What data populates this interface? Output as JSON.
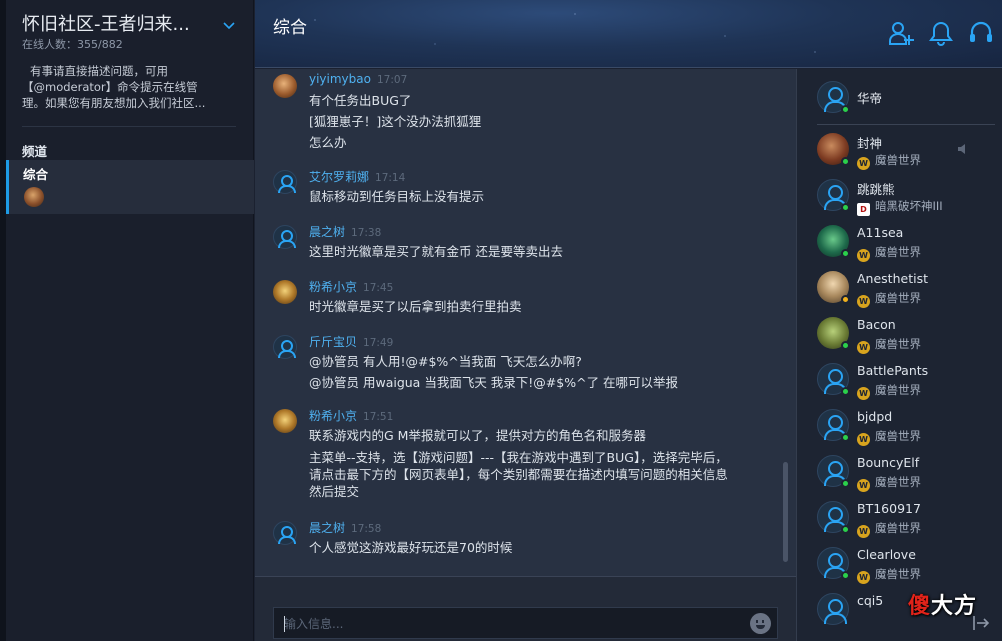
{
  "community": {
    "title": "怀旧社区-王者归来...",
    "online": "在线人数：355/882",
    "notice_lines": [
      "有事请直接描述问题，可用",
      "【@moderator】命令提示在线管",
      "理。如果您有朋友想加入我们社区..."
    ],
    "channels_heading": "频道",
    "channel_name": "综合"
  },
  "header": {
    "title": "综合",
    "icons": [
      "add-friend-icon",
      "bell-icon",
      "headset-icon"
    ],
    "accent": "#2aa4f4"
  },
  "messages": [
    {
      "author": "yiyimybao",
      "time": "17:07",
      "lines": [
        "有个任务出BUG了",
        "[狐狸崽子！]这个没办法抓狐狸",
        "怎么办"
      ]
    },
    {
      "author": "艾尔罗莉娜",
      "time": "17:14",
      "lines": [
        "鼠标移动到任务目标上没有提示"
      ]
    },
    {
      "author": "晨之树",
      "time": "17:38",
      "lines": [
        "这里时光徽章是买了就有金币 还是要等卖出去"
      ]
    },
    {
      "author": "粉希小京",
      "time": "17:45",
      "lines": [
        "时光徽章是买了以后拿到拍卖行里拍卖"
      ]
    },
    {
      "author": "斤斤宝贝",
      "time": "17:49",
      "lines": [
        "@协管员 有人用!@#$%^当我面 飞天怎么办啊?",
        "@协管员 用waigua 当我面飞天 我录下!@#$%^了 在哪可以举报"
      ]
    },
    {
      "author": "粉希小京",
      "time": "17:51",
      "lines": [
        "联系游戏内的G M举报就可以了，提供对方的角色名和服务器",
        "主菜单--支持，选【游戏问题】---【我在游戏中遇到了BUG】，选择完毕后，",
        "请点击最下方的【网页表单】，每个类别都需要在描述内填写问题的相关信息",
        "然后提交"
      ]
    },
    {
      "author": "晨之树",
      "time": "17:58",
      "lines": [
        "个人感觉这游戏最好玩还是70的时候"
      ]
    }
  ],
  "input": {
    "placeholder": "输入信息..."
  },
  "members": {
    "me": "华帝",
    "list": [
      {
        "name": "封神",
        "game": "魔兽世界",
        "badge": "W"
      },
      {
        "name": "跳跳熊",
        "game": "暗黑破坏神III",
        "badge": "D"
      },
      {
        "name": "A11sea",
        "game": "魔兽世界",
        "badge": "W"
      },
      {
        "name": "Anesthetist",
        "game": "魔兽世界",
        "badge": "W"
      },
      {
        "name": "Bacon",
        "game": "魔兽世界",
        "badge": "W"
      },
      {
        "name": "BattlePants",
        "game": "魔兽世界",
        "badge": "W"
      },
      {
        "name": "bjdpd",
        "game": "魔兽世界",
        "badge": "W"
      },
      {
        "name": "BouncyElf",
        "game": "魔兽世界",
        "badge": "W"
      },
      {
        "name": "BT160917",
        "game": "魔兽世界",
        "badge": "W"
      },
      {
        "name": "Clearlove",
        "game": "魔兽世界",
        "badge": "W"
      },
      {
        "name": "cqi5",
        "game": "",
        "badge": ""
      }
    ]
  },
  "watermark": {
    "a": "傻",
    "b": "大方"
  }
}
